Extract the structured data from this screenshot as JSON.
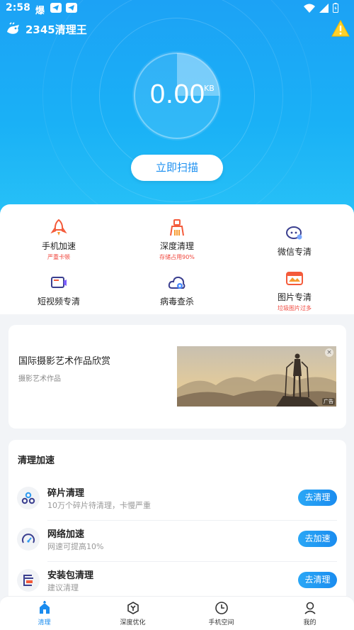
{
  "status_bar": {
    "time": "2:58",
    "carrier_glyph": "爆"
  },
  "header": {
    "title": "2345清理王"
  },
  "gauge": {
    "value": "0.00",
    "unit": "KB",
    "progress": 0.25
  },
  "scan_button": {
    "label": "立即扫描"
  },
  "features": [
    {
      "label": "手机加速",
      "sub": "严重卡顿",
      "icon": "rocket-icon"
    },
    {
      "label": "深度清理",
      "sub": "存储占用90%",
      "icon": "broom-icon"
    },
    {
      "label": "微信专清",
      "sub": "",
      "icon": "wechat-icon"
    },
    {
      "label": "短视频专清",
      "sub": "",
      "icon": "video-icon"
    },
    {
      "label": "病毒查杀",
      "sub": "",
      "icon": "virus-cloud-icon"
    },
    {
      "label": "图片专清",
      "sub": "垃圾图片过多",
      "icon": "image-icon"
    }
  ],
  "ad": {
    "title": "国际摄影艺术作品欣赏",
    "subtitle": "摄影艺术作品",
    "tag": "广告",
    "close": "×"
  },
  "speed_section": {
    "title": "清理加速",
    "rows": [
      {
        "title": "碎片清理",
        "subtitle": "10万个碎片待清理，卡慢严重",
        "button": "去清理",
        "icon": "fragments-icon"
      },
      {
        "title": "网络加速",
        "subtitle": "网速可提高10%",
        "button": "去加速",
        "icon": "speedometer-icon"
      },
      {
        "title": "安装包清理",
        "subtitle": "建议清理",
        "button": "去清理",
        "icon": "apk-icon"
      }
    ]
  },
  "bottom_nav": [
    {
      "label": "清理",
      "active": true
    },
    {
      "label": "深度优化",
      "active": false
    },
    {
      "label": "手机空间",
      "active": false
    },
    {
      "label": "我的",
      "active": false
    }
  ],
  "colors": {
    "primary": "#1a8cef",
    "hero_top": "#1ca2f5",
    "hero_bottom": "#29c3f7",
    "warning": "#f0463c"
  }
}
